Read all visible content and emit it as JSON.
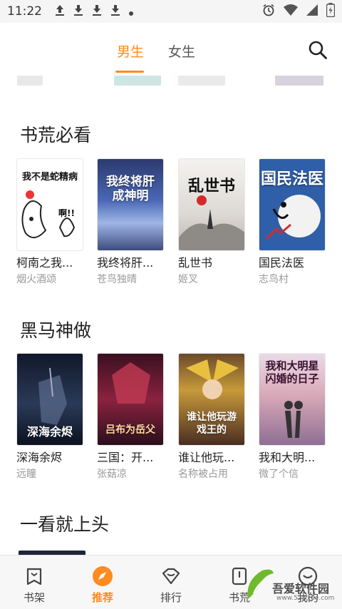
{
  "status_bar": {
    "time": "11:22",
    "icons": [
      "upload-icon",
      "download-icon",
      "download-icon",
      "download-icon",
      "dot-icon"
    ],
    "right_icons": [
      "alarm-icon",
      "wifi-icon",
      "signal-icon",
      "battery-icon"
    ]
  },
  "top_tabs": [
    {
      "label": "男生",
      "active": true
    },
    {
      "label": "女生",
      "active": false
    }
  ],
  "sections": [
    {
      "title": "书荒必看",
      "books": [
        {
          "title": "柯南之我...",
          "author": "烟火酒颂",
          "cover_text": "我不是蛇精病",
          "cover_color": "#ffffff"
        },
        {
          "title": "我终将肝...",
          "author": "苍鸟独晴",
          "cover_text": "我终将肝成神明",
          "cover_color": "#3b4f8f"
        },
        {
          "title": "乱世书",
          "author": "姬叉",
          "cover_text": "乱世书",
          "cover_color": "#e9e6e3"
        },
        {
          "title": "国民法医",
          "author": "志鸟村",
          "cover_text": "国民法医",
          "cover_color": "#2f5fa8"
        }
      ]
    },
    {
      "title": "黑马神做",
      "books": [
        {
          "title": "深海余烬",
          "author": "远瞳",
          "cover_text": "深海余烬",
          "cover_color": "#1d2638"
        },
        {
          "title": "三国：开...",
          "author": "张菇凉",
          "cover_text": "吕布为岳父",
          "cover_color": "#7a1a2e"
        },
        {
          "title": "谁让他玩...",
          "author": "名称被占用",
          "cover_text": "谁让他玩游戏王的",
          "cover_color": "#3a2a26"
        },
        {
          "title": "我和大明...",
          "author": "微了个信",
          "cover_text": "我和大明星闪婚的日子",
          "cover_color": "#c8b8d0"
        }
      ]
    },
    {
      "title": "一看就上头",
      "books": []
    }
  ],
  "bottom_nav": [
    {
      "label": "书架",
      "icon": "bookshelf-icon",
      "active": false
    },
    {
      "label": "推荐",
      "icon": "compass-icon",
      "active": true
    },
    {
      "label": "排行",
      "icon": "ranking-icon",
      "active": false
    },
    {
      "label": "书荒",
      "icon": "bookshelf-tag-icon",
      "active": false
    },
    {
      "label": "我的",
      "icon": "profile-icon",
      "active": false
    }
  ],
  "watermark": {
    "text": "吾爱软件园",
    "url": "www.52zixue.com"
  },
  "colors": {
    "accent": "#ff8a1f",
    "muted": "#999999"
  }
}
